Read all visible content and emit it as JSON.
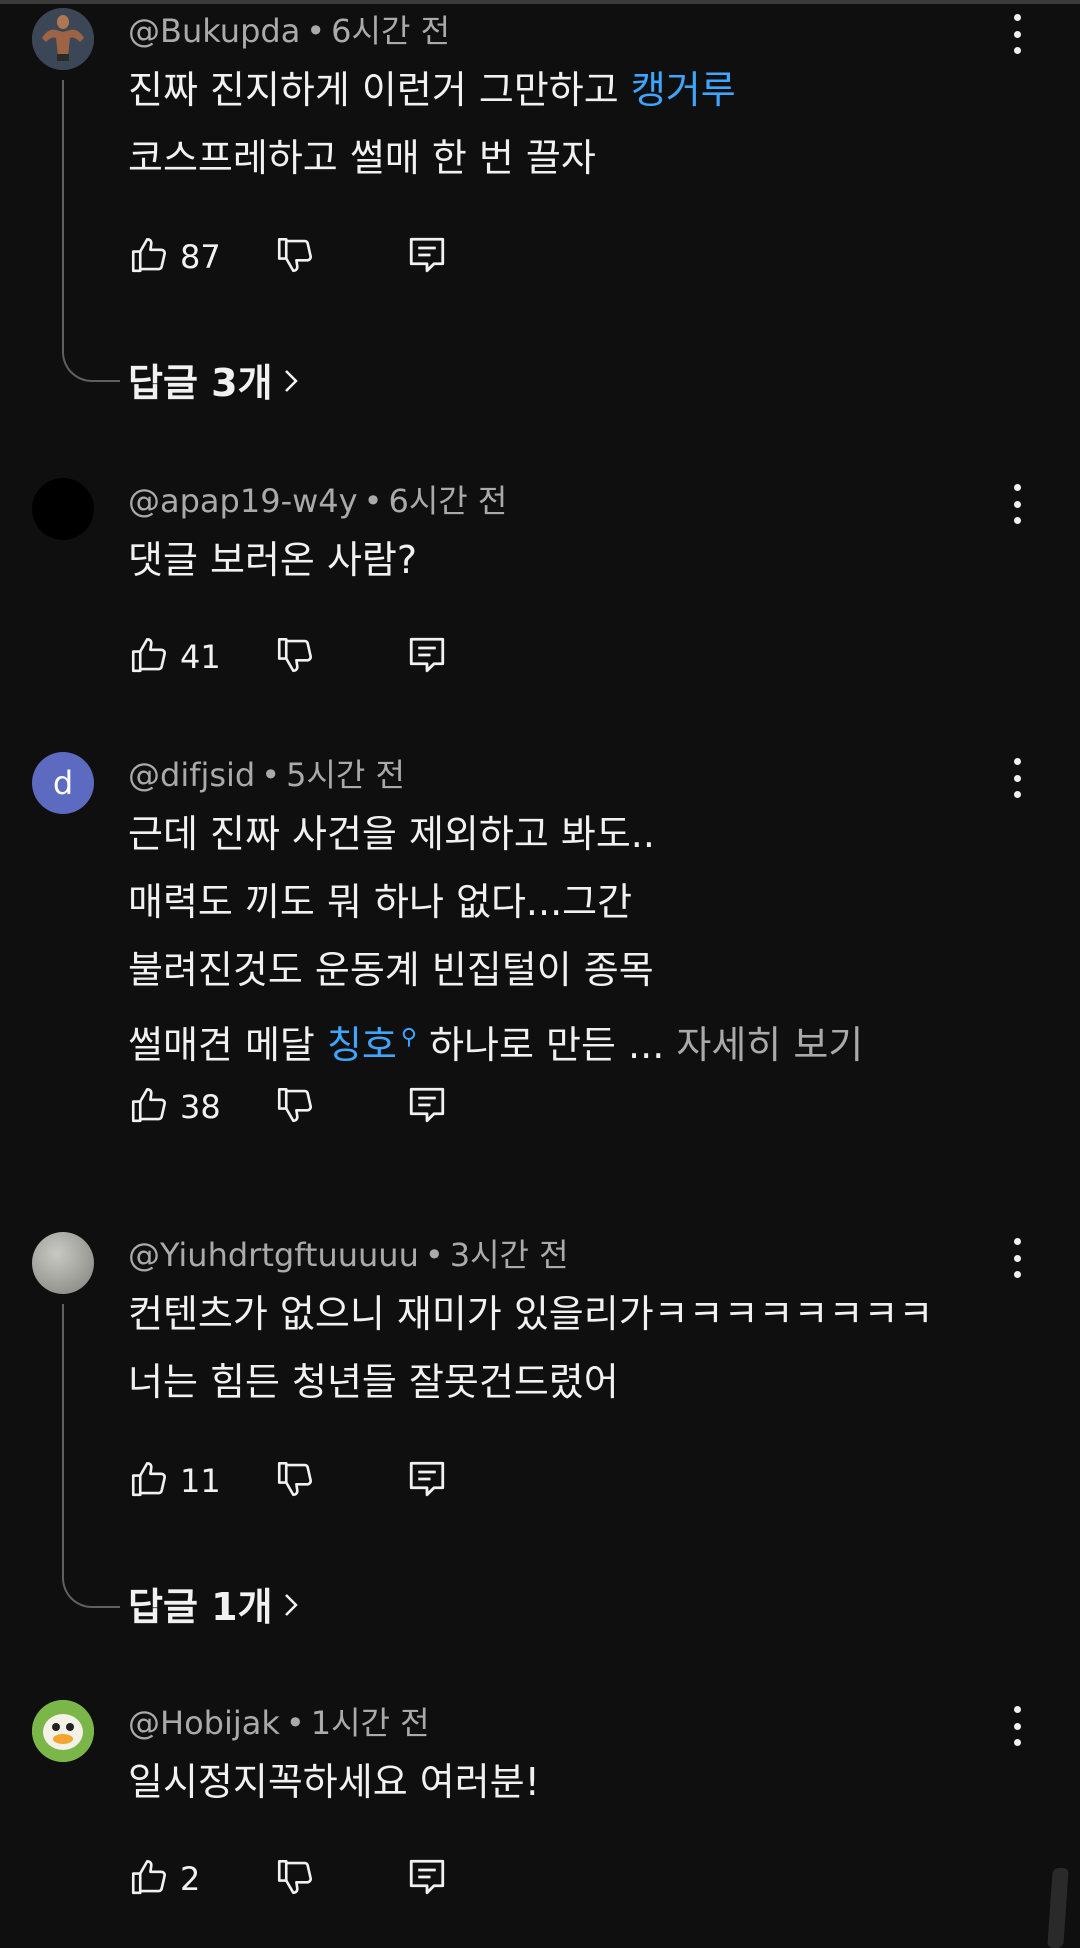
{
  "comments": [
    {
      "handle": "@Bukupda",
      "time": "6시간 전",
      "lines": [
        "진짜 진지하게 이런거 그만하고 ",
        "코스프레하고 썰매 한 번 끌자"
      ],
      "link_text": "캥거루",
      "likes": "87",
      "replies_label": "답글 3개"
    },
    {
      "handle": "@apap19-w4y",
      "time": "6시간 전",
      "lines": [
        "댓글 보러온 사람?"
      ],
      "likes": "41"
    },
    {
      "avatar_letter": "d",
      "handle": "@difjsid",
      "time": "5시간 전",
      "lines": [
        "근데 진짜 사건을 제외하고 봐도..",
        "매력도 끼도 뭐 하나 없다...그간",
        "불려진것도 운동계 빈집털이 종목",
        "썰매견 메달 "
      ],
      "link_text": "칭호",
      "tail_text": " 하나로 만든 ... ",
      "more_label": "자세히 보기",
      "likes": "38"
    },
    {
      "handle": "@Yiuhdrtgftuuuuu",
      "time": "3시간 전",
      "lines": [
        "컨텐츠가 없으니 재미가 있을리가ㅋㅋㅋㅋㅋㅋㅋㅋ",
        "너는 힘든 청년들 잘못건드렸어"
      ],
      "likes": "11",
      "replies_label": "답글 1개"
    },
    {
      "handle": "@Hobijak",
      "time": "1시간 전",
      "lines": [
        "일시정지꼭하세요 여러분!"
      ],
      "likes": "2"
    }
  ],
  "icons": {
    "like": "thumbs-up-icon",
    "dislike": "thumbs-down-icon",
    "reply": "reply-comment-icon",
    "more": "more-vert-icon",
    "chevron": "chevron-right-icon"
  },
  "colors": {
    "background": "#0f0f0f",
    "link": "#3ea6ff",
    "meta": "#aaaaaa",
    "avatar_letter_bg": "#5c6bc0"
  }
}
